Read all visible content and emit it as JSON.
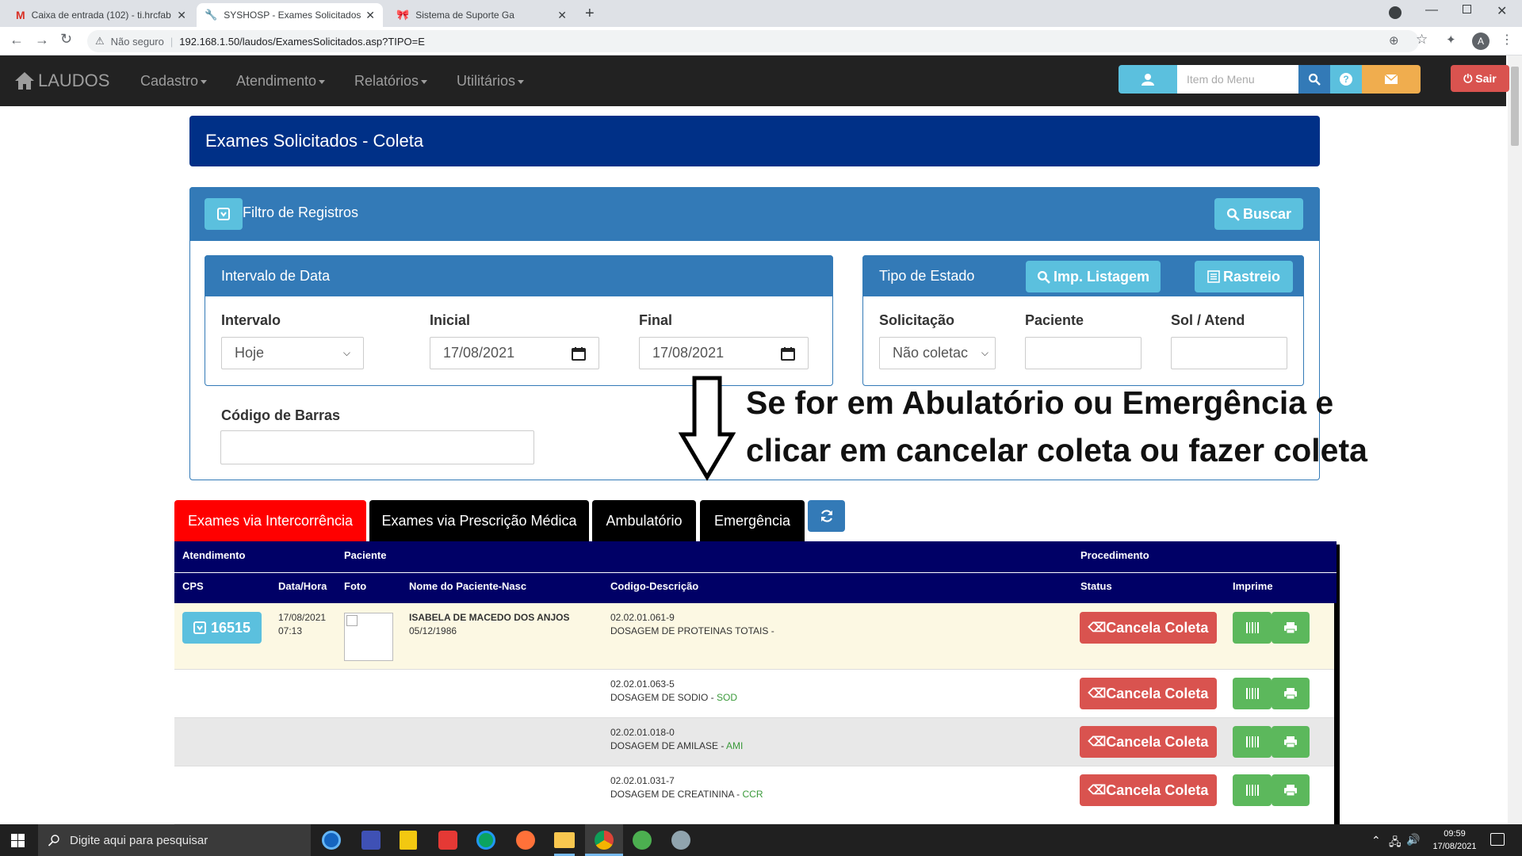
{
  "browser": {
    "tabs": [
      {
        "title": "Caixa de entrada (102) - ti.hrcfab",
        "icon": "gmail-icon"
      },
      {
        "title": "SYSHOSP - Exames Solicitados",
        "icon": "tools-icon"
      },
      {
        "title": "Sistema de Suporte Ga",
        "icon": "support-icon"
      }
    ],
    "security_label": "Não seguro",
    "url": "192.168.1.50/laudos/ExamesSolicitados.asp?TIPO=E",
    "profile_initial": "A"
  },
  "navbar": {
    "brand": "LAUDOS",
    "menus": [
      "Cadastro",
      "Atendimento",
      "Relatórios",
      "Utilitários"
    ],
    "search_placeholder": "Item do Menu",
    "logout_label": "Sair"
  },
  "page": {
    "title": "Exames Solicitados - Coleta",
    "filter": {
      "title": "Filtro de Registros",
      "search_label": "Buscar",
      "date_panel": {
        "title": "Intervalo de Data",
        "interval_label": "Intervalo",
        "interval_value": "Hoje",
        "start_label": "Inicial",
        "start_value": "17/08/2021",
        "end_label": "Final",
        "end_value": "17/08/2021"
      },
      "state_panel": {
        "title": "Tipo de Estado",
        "print_list_label": "Imp. Listagem",
        "tracking_label": "Rastreio",
        "request_label": "Solicitação",
        "request_value": "Não coletac",
        "patient_label": "Paciente",
        "sol_label": "Sol / Atend"
      },
      "barcode_label": "Código de Barras"
    },
    "annotation": {
      "line1": "Se for em Abulatório ou Emergência e",
      "line2": "clicar em cancelar coleta ou fazer coleta"
    },
    "tabs": [
      "Exames via Intercorrência",
      "Exames via Prescrição Médica",
      "Ambulatório",
      "Emergência"
    ],
    "table": {
      "group_headers": {
        "atendimento": "Atendimento",
        "paciente": "Paciente",
        "procedimento": "Procedimento"
      },
      "headers": {
        "cps": "CPS",
        "datetime": "Data/Hora",
        "photo": "Foto",
        "name": "Nome do Paciente-Nasc",
        "code": "Codigo-Descrição",
        "status": "Status",
        "print": "Imprime"
      },
      "patient": {
        "cps": "16515",
        "date": "17/08/2021",
        "time": "07:13",
        "name": "ISABELA DE MACEDO DOS ANJOS",
        "birth": "05/12/1986"
      },
      "rows": [
        {
          "code": "02.02.01.061-9",
          "desc": "DOSAGEM DE PROTEINAS TOTAIS -",
          "abbr": ""
        },
        {
          "code": "02.02.01.063-5",
          "desc": "DOSAGEM DE SODIO -",
          "abbr": "SOD"
        },
        {
          "code": "02.02.01.018-0",
          "desc": "DOSAGEM DE AMILASE -",
          "abbr": "AMI"
        },
        {
          "code": "02.02.01.031-7",
          "desc": "DOSAGEM DE CREATININA -",
          "abbr": "CCR"
        }
      ],
      "cancel_label": "Cancela Coleta"
    }
  },
  "taskbar": {
    "search_placeholder": "Digite aqui para pesquisar",
    "time": "09:59",
    "date": "17/08/2021"
  },
  "colors": {
    "title_bar": "#003087",
    "filter_header": "#337ab7",
    "table_header": "#000066",
    "active_tab": "#ff0000",
    "highlight_row": "#fcf8e3"
  }
}
